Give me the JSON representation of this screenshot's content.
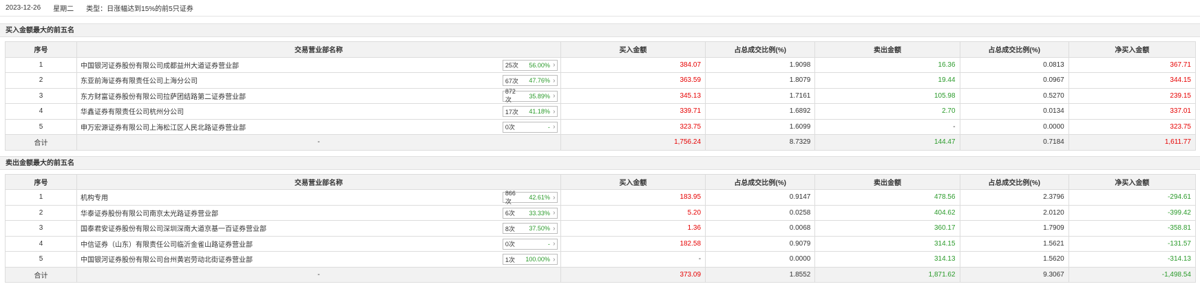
{
  "topbar": {
    "date": "2023-12-26",
    "weekday": "星期二",
    "type_label": "类型：日涨幅达到15%的前5只证券"
  },
  "headers": [
    "序号",
    "交易营业部名称",
    "买入金额",
    "占总成交比例(%)",
    "卖出金额",
    "占总成交比例(%)",
    "净买入金额"
  ],
  "buy": {
    "title": "买入金额最大的前五名",
    "rows": [
      {
        "idx": "1",
        "name": "中国银河证券股份有限公司成都益州大道证券营业部",
        "cnt": "25次",
        "pct": "56.00%",
        "buy": "384.07",
        "buy_ratio": "1.9098",
        "sell": "16.36",
        "sell_ratio": "0.0813",
        "net": "367.71"
      },
      {
        "idx": "2",
        "name": "东亚前海证券有限责任公司上海分公司",
        "cnt": "67次",
        "pct": "47.76%",
        "buy": "363.59",
        "buy_ratio": "1.8079",
        "sell": "19.44",
        "sell_ratio": "0.0967",
        "net": "344.15"
      },
      {
        "idx": "3",
        "name": "东方财富证券股份有限公司拉萨团结路第二证券营业部",
        "cnt": "872次",
        "pct": "35.89%",
        "buy": "345.13",
        "buy_ratio": "1.7161",
        "sell": "105.98",
        "sell_ratio": "0.5270",
        "net": "239.15"
      },
      {
        "idx": "4",
        "name": "华鑫证券有限责任公司杭州分公司",
        "cnt": "17次",
        "pct": "41.18%",
        "buy": "339.71",
        "buy_ratio": "1.6892",
        "sell": "2.70",
        "sell_ratio": "0.0134",
        "net": "337.01"
      },
      {
        "idx": "5",
        "name": "申万宏源证券有限公司上海松江区人民北路证券营业部",
        "cnt": "0次",
        "pct": "-",
        "buy": "323.75",
        "buy_ratio": "1.6099",
        "sell": "-",
        "sell_ratio": "0.0000",
        "net": "323.75"
      }
    ],
    "total": {
      "label": "合计",
      "name": "-",
      "buy": "1,756.24",
      "buy_ratio": "8.7329",
      "sell": "144.47",
      "sell_ratio": "0.7184",
      "net": "1,611.77"
    }
  },
  "sell": {
    "title": "卖出金额最大的前五名",
    "rows": [
      {
        "idx": "1",
        "name": "机构专用",
        "cnt": "866次",
        "pct": "42.61%",
        "buy": "183.95",
        "buy_ratio": "0.9147",
        "sell": "478.56",
        "sell_ratio": "2.3796",
        "net": "-294.61"
      },
      {
        "idx": "2",
        "name": "华泰证券股份有限公司南京太光路证券营业部",
        "cnt": "6次",
        "pct": "33.33%",
        "buy": "5.20",
        "buy_ratio": "0.0258",
        "sell": "404.62",
        "sell_ratio": "2.0120",
        "net": "-399.42"
      },
      {
        "idx": "3",
        "name": "国泰君安证券股份有限公司深圳深南大道京基一百证券营业部",
        "cnt": "8次",
        "pct": "37.50%",
        "buy": "1.36",
        "buy_ratio": "0.0068",
        "sell": "360.17",
        "sell_ratio": "1.7909",
        "net": "-358.81"
      },
      {
        "idx": "4",
        "name": "中信证券（山东）有限责任公司临沂金雀山路证券营业部",
        "cnt": "0次",
        "pct": "-",
        "buy": "182.58",
        "buy_ratio": "0.9079",
        "sell": "314.15",
        "sell_ratio": "1.5621",
        "net": "-131.57"
      },
      {
        "idx": "5",
        "name": "中国银河证券股份有限公司台州黄岩劳动北街证券营业部",
        "cnt": "1次",
        "pct": "100.00%",
        "buy": "-",
        "buy_ratio": "0.0000",
        "sell": "314.13",
        "sell_ratio": "1.5620",
        "net": "-314.13"
      }
    ],
    "total": {
      "label": "合计",
      "name": "-",
      "buy": "373.09",
      "buy_ratio": "1.8552",
      "sell": "1,871.62",
      "sell_ratio": "9.3067",
      "net": "-1,498.54"
    }
  },
  "colors": {
    "buy_color": "#e60000",
    "sell_color": "#2a9a2a",
    "header_bg": "#f2f2f2"
  }
}
